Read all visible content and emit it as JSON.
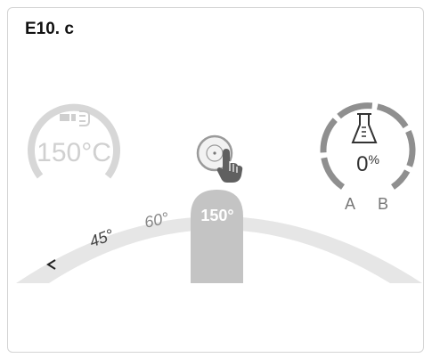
{
  "header": {
    "title": "E10. c"
  },
  "temp_gauge": {
    "value_label": "150°C",
    "icon": "blower-icon",
    "color": "#cfcfcf"
  },
  "start_button": {
    "icon": "touch-hand-icon"
  },
  "reagent_gauge": {
    "icon": "flask-icon",
    "percent": "0",
    "percent_unit": "%",
    "label_a": "A",
    "label_b": "B",
    "color": "#8f8f8f"
  },
  "arc_scale": {
    "labels": [
      "45°",
      "60°"
    ],
    "selected_label": "150°",
    "back_icon": "chevron-left-icon",
    "arc_color": "#e6e6e6",
    "selector_color": "#c4c4c4"
  }
}
